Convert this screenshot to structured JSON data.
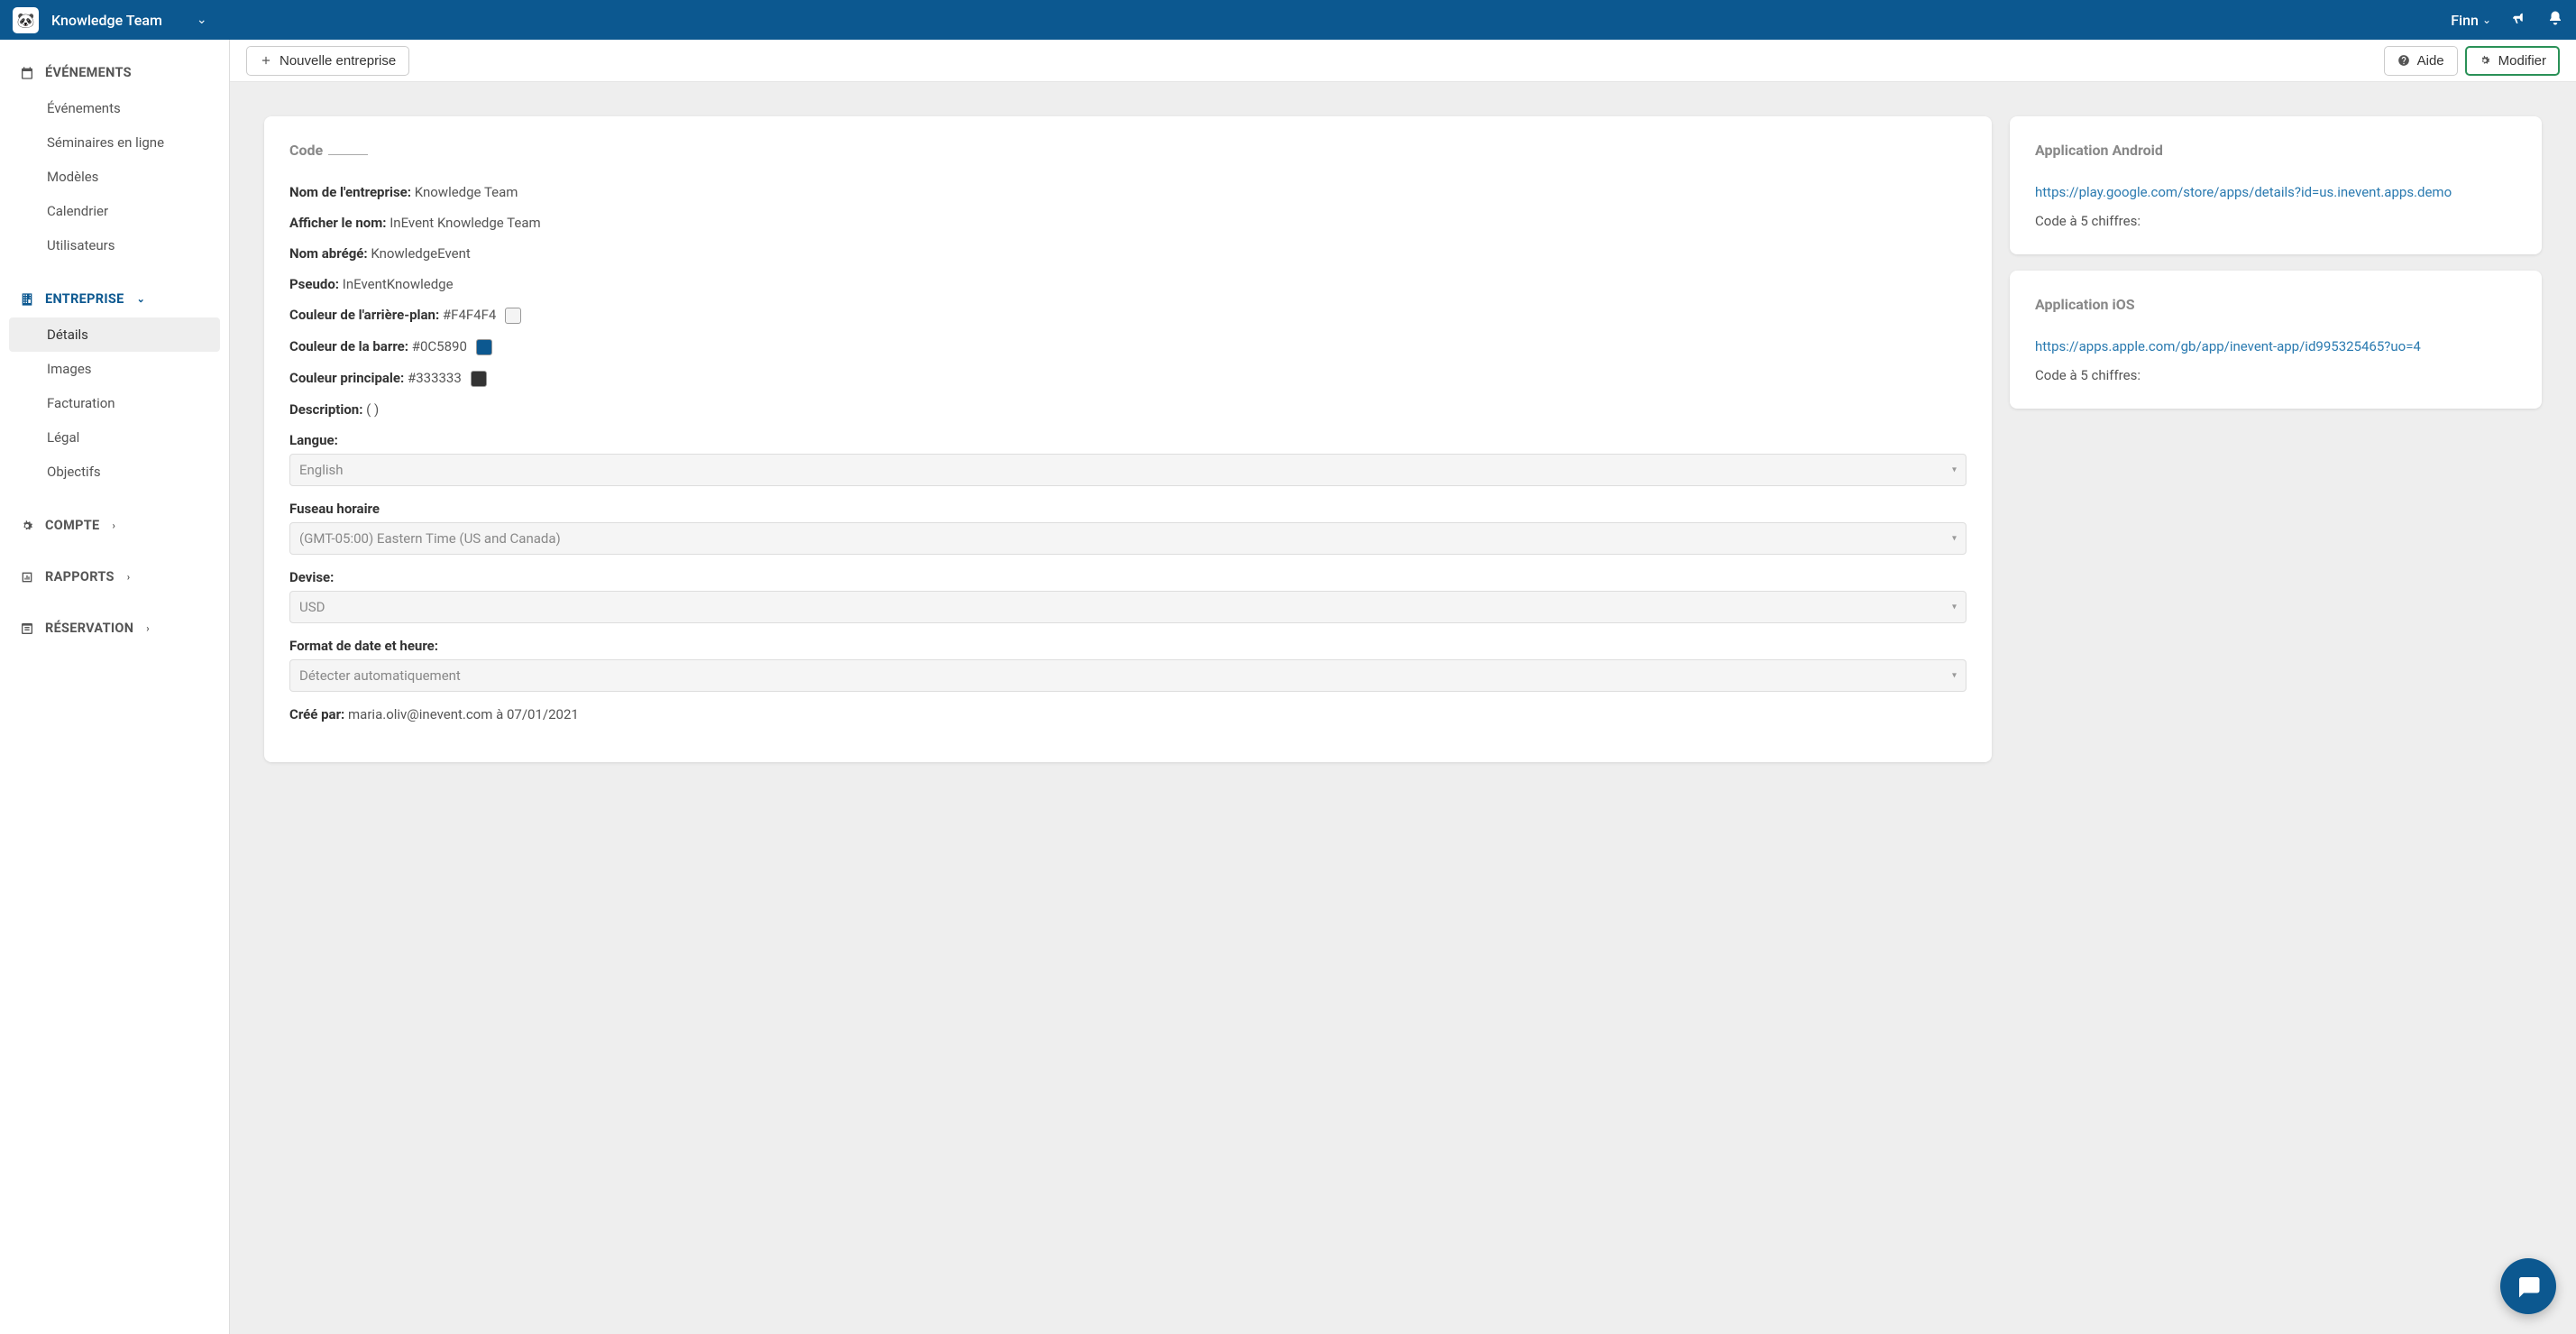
{
  "topbar": {
    "team_name": "Knowledge Team",
    "user_name": "Finn"
  },
  "sidebar": {
    "sections": {
      "events": {
        "heading": "ÉVÉNEMENTS",
        "items": [
          "Événements",
          "Séminaires en ligne",
          "Modèles",
          "Calendrier",
          "Utilisateurs"
        ]
      },
      "enterprise": {
        "heading": "ENTREPRISE",
        "items": [
          "Détails",
          "Images",
          "Facturation",
          "Légal",
          "Objectifs"
        ],
        "active_index": 0
      },
      "account": {
        "heading": "COMPTE"
      },
      "reports": {
        "heading": "RAPPORTS"
      },
      "reservation": {
        "heading": "RÉSERVATION"
      }
    }
  },
  "toolbar": {
    "new_label": "Nouvelle entreprise",
    "help_label": "Aide",
    "edit_label": "Modifier"
  },
  "details": {
    "code_label": "Code",
    "fields": {
      "company_name": {
        "label": "Nom de l'entreprise:",
        "value": "Knowledge Team"
      },
      "display_name": {
        "label": "Afficher le nom:",
        "value": "InEvent Knowledge Team"
      },
      "short_name": {
        "label": "Nom abrégé:",
        "value": "KnowledgeEvent"
      },
      "pseudo": {
        "label": "Pseudo:",
        "value": "InEventKnowledge"
      },
      "bg_color": {
        "label": "Couleur de l'arrière-plan:",
        "value": "#F4F4F4"
      },
      "bar_color": {
        "label": "Couleur de la barre:",
        "value": "#0C5890"
      },
      "main_color": {
        "label": "Couleur principale:",
        "value": "#333333"
      },
      "description": {
        "label": "Description:",
        "value": "( )"
      },
      "language": {
        "label": "Langue:",
        "value": "English"
      },
      "timezone": {
        "label": "Fuseau horaire",
        "value": "(GMT-05:00) Eastern Time (US and Canada)"
      },
      "currency": {
        "label": "Devise:",
        "value": "USD"
      },
      "datetime_format": {
        "label": "Format de date et heure:",
        "value": "Détecter automatiquement"
      },
      "created_by": {
        "label": "Créé par:",
        "value": "maria.oliv@inevent.com à 07/01/2021"
      }
    }
  },
  "apps": {
    "android": {
      "title": "Application Android",
      "url": "https://play.google.com/store/apps/details?id=us.inevent.apps.demo",
      "code_label": "Code à 5 chiffres:"
    },
    "ios": {
      "title": "Application iOS",
      "url": "https://apps.apple.com/gb/app/inevent-app/id995325465?uo=4",
      "code_label": "Code à 5 chiffres:"
    }
  }
}
